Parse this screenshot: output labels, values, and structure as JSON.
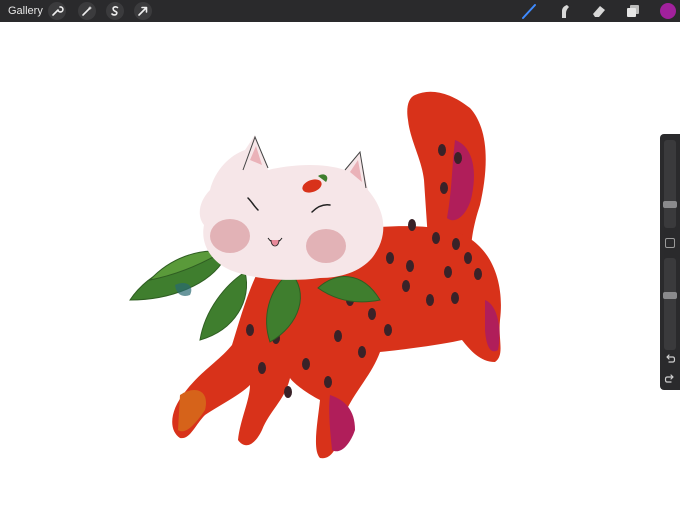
{
  "topbar": {
    "gallery_label": "Gallery",
    "left_tools": [
      "wrench-icon",
      "magic-wand-icon",
      "selection-icon",
      "transform-icon"
    ],
    "right_tools": [
      "brush-icon",
      "smudge-icon",
      "eraser-icon",
      "layers-icon"
    ],
    "active_tool": "brush-icon",
    "current_color": "#a1219c",
    "accent_color": "#3f8bff"
  },
  "sidebar": {
    "brush_size_level": 0.25,
    "opacity_level": 0.6,
    "controls": [
      "modify-button",
      "undo-icon",
      "redo-icon"
    ]
  },
  "canvas": {
    "background": "#ffffff",
    "colors": {
      "body": "#d8321a",
      "accent": "#b01e5a",
      "spots": "#3a2228",
      "face": "#f6e6e8",
      "cheeks": "#e8b4b8",
      "leaves": "#3f7e2e"
    }
  }
}
